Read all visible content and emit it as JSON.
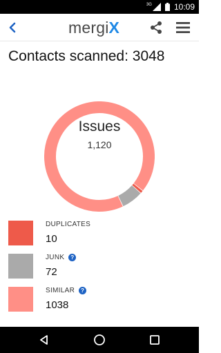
{
  "status_bar": {
    "signal_label": "3G",
    "time": "10:09"
  },
  "app_bar": {
    "logo_main": "mergi",
    "logo_x": "X",
    "back_icon": "chevron-left-icon",
    "share_icon": "share-icon",
    "menu_icon": "hamburger-menu-icon"
  },
  "summary": {
    "scanned_text": "Contacts scanned: 3048"
  },
  "donut": {
    "title": "Issues",
    "total": "1,120"
  },
  "chart_data": {
    "type": "pie",
    "title": "Issues",
    "categories": [
      "DUPLICATES",
      "JUNK",
      "SIMILAR"
    ],
    "values": [
      10,
      72,
      1038
    ],
    "colors": [
      "#ee5a4a",
      "#aaaaaa",
      "#ff8f86"
    ]
  },
  "legend": [
    {
      "label": "DUPLICATES",
      "count": "10",
      "color": "#ee5a4a",
      "help": false
    },
    {
      "label": "JUNK",
      "count": "72",
      "color": "#aaaaaa",
      "help": true
    },
    {
      "label": "SIMILAR",
      "count": "1038",
      "color": "#ff8f86",
      "help": true
    }
  ],
  "nav_bar": {
    "back": "triangle-back-icon",
    "home": "circle-home-icon",
    "recents": "square-recents-icon"
  }
}
